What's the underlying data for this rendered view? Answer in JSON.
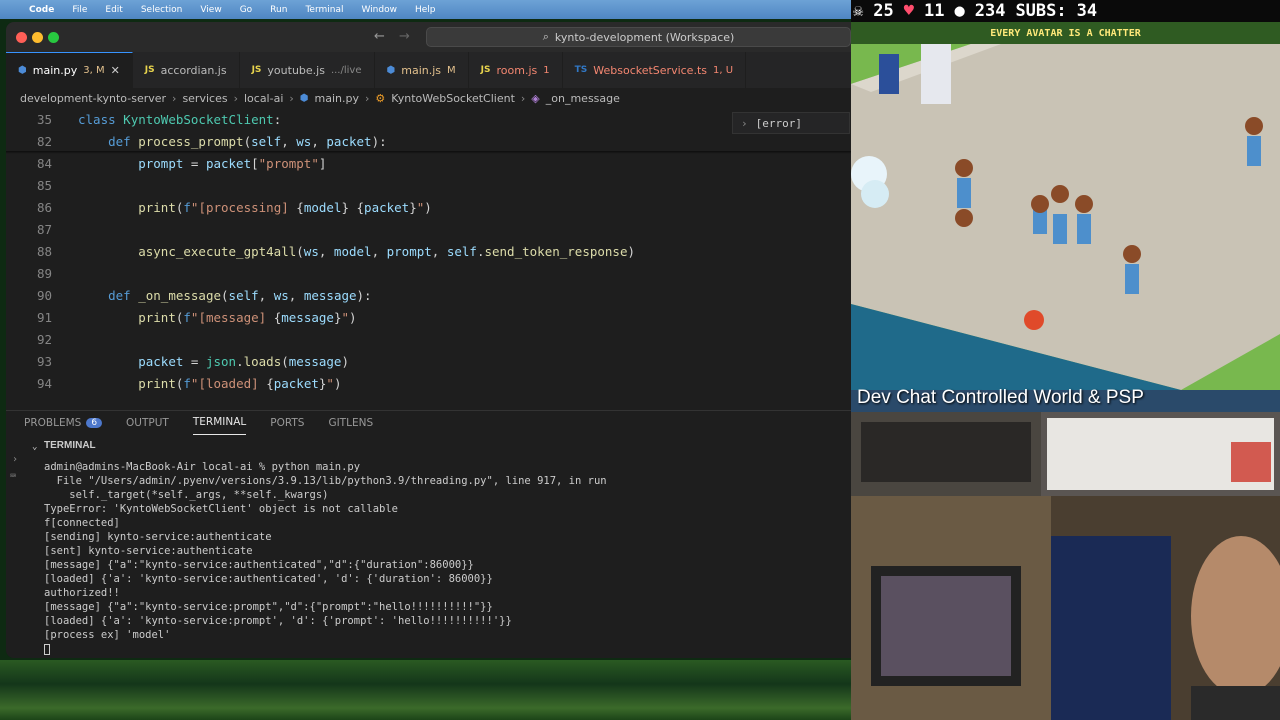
{
  "menubar": {
    "app_name": "Code",
    "items": [
      "File",
      "Edit",
      "Selection",
      "View",
      "Go",
      "Run",
      "Terminal",
      "Window",
      "Help"
    ]
  },
  "window": {
    "search_text": "kynto-development (Workspace)"
  },
  "tabs": [
    {
      "icon": "python-icon",
      "label": "main.py",
      "status": "3, M",
      "active": true
    },
    {
      "icon": "js-icon",
      "label": "accordian.js",
      "status": ""
    },
    {
      "icon": "js-icon",
      "label": "youtube.js",
      "desc": ".../live",
      "status": ""
    },
    {
      "icon": "python-icon",
      "label": "main.js",
      "status": "M"
    },
    {
      "icon": "js-icon",
      "label": "room.js",
      "status": "1"
    },
    {
      "icon": "ts-icon",
      "label": "WebsocketService.ts",
      "status": "1, U"
    }
  ],
  "breadcrumbs": [
    "development-kynto-server",
    "services",
    "local-ai",
    "main.py",
    "KyntoWebSocketClient",
    "_on_message"
  ],
  "editor": {
    "error_widget": "[error]",
    "lines": [
      {
        "n": "35",
        "text": "class KyntoWebSocketClient:"
      },
      {
        "n": "82",
        "text": "    def process_prompt(self, ws, packet):"
      },
      {
        "n": "84",
        "text": "        prompt = packet[\"prompt\"]"
      },
      {
        "n": "85",
        "text": ""
      },
      {
        "n": "86",
        "text": "        print(f\"[processing] {model} {packet}\")"
      },
      {
        "n": "87",
        "text": ""
      },
      {
        "n": "88",
        "text": "        async_execute_gpt4all(ws, model, prompt, self.send_token_response)"
      },
      {
        "n": "89",
        "text": ""
      },
      {
        "n": "90",
        "text": "    def _on_message(self, ws, message):"
      },
      {
        "n": "91",
        "text": "        print(f\"[message] {message}\")"
      },
      {
        "n": "92",
        "text": ""
      },
      {
        "n": "93",
        "text": "        packet = json.loads(message)"
      },
      {
        "n": "94",
        "text": "        print(f\"[loaded] {packet}\")"
      }
    ]
  },
  "panel": {
    "tabs": [
      {
        "label": "PROBLEMS",
        "badge": "6"
      },
      {
        "label": "OUTPUT"
      },
      {
        "label": "TERMINAL",
        "active": true
      },
      {
        "label": "PORTS"
      },
      {
        "label": "GITLENS"
      }
    ],
    "terminal_header": "TERMINAL",
    "terminal_lines": [
      "admin@admins-MacBook-Air local-ai % python main.py",
      "  File \"/Users/admin/.pyenv/versions/3.9.13/lib/python3.9/threading.py\", line 917, in run",
      "    self._target(*self._args, **self._kwargs)",
      "TypeError: 'KyntoWebSocketClient' object is not callable",
      "f[connected]",
      "[sending] kynto-service:authenticate",
      "[sent] kynto-service:authenticate",
      "[message] {\"a\":\"kynto-service:authenticated\",\"d\":{\"duration\":86000}}",
      "[loaded] {'a': 'kynto-service:authenticated', 'd': {'duration': 86000}}",
      "authorized!!",
      "[message] {\"a\":\"kynto-service:prompt\",\"d\":{\"prompt\":\"hello!!!!!!!!!!\"}}",
      "[loaded] {'a': 'kynto-service:prompt', 'd': {'prompt': 'hello!!!!!!!!!!'}}",
      "[process ex] 'model'"
    ]
  },
  "game": {
    "hud": {
      "stat1": "25",
      "stat2": "11",
      "stat3": "234",
      "subs_label": "SUBS:",
      "subs_value": "34"
    },
    "banner": "EVERY AVATAR IS A CHATTER",
    "title": "Dev Chat Controlled World & PSP"
  },
  "colors": {
    "accent": "#3794ff",
    "menubar": "#5a8fca",
    "editor_bg": "#1e1e1e",
    "game_banner_bg": "#2f5b22"
  }
}
